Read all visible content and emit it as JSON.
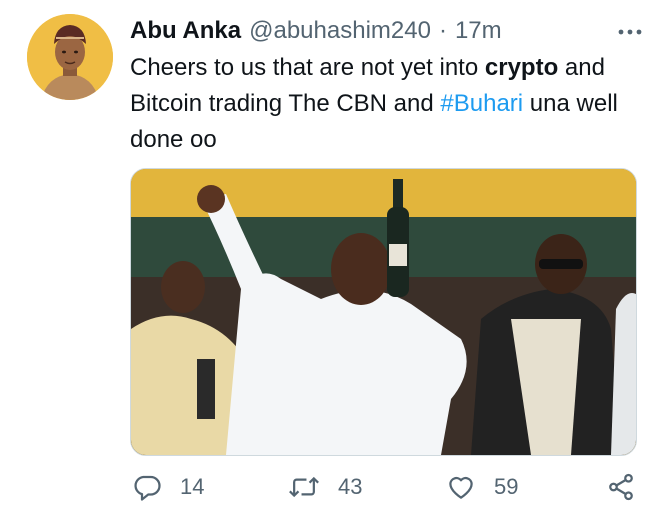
{
  "tweet": {
    "author_name": "Abu Anka",
    "handle": "@abuhashim240",
    "separator": "·",
    "time": "17m",
    "text_parts": {
      "p1": "Cheers to us that are not yet into ",
      "p2": "crypto",
      "p3": " and Bitcoin trading The CBN and ",
      "hashtag": "#Buhari",
      "p4": " una well done oo"
    }
  },
  "actions": {
    "reply_count": "14",
    "retweet_count": "43",
    "like_count": "59"
  },
  "icons": {
    "more": "more-options-icon",
    "reply": "reply-icon",
    "retweet": "retweet-icon",
    "like": "heart-icon",
    "share": "share-icon"
  },
  "colors": {
    "text": "#0f1419",
    "secondary": "#536471",
    "link": "#1d9bf0"
  }
}
